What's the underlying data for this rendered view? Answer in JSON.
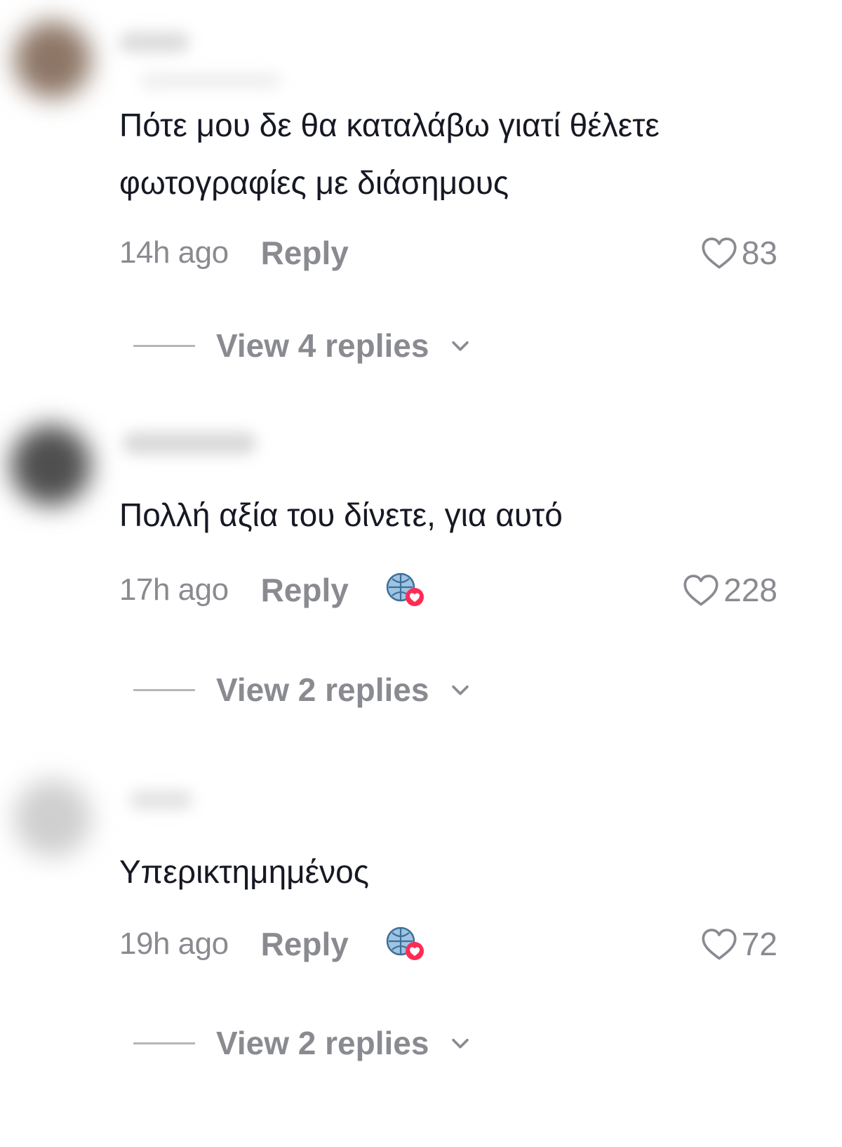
{
  "comments": [
    {
      "text": "Πότε μου δε θα καταλάβω γιατί θέλετε φωτογραφίες με διάσημους",
      "time": "14h ago",
      "reply_label": "Reply",
      "likes": "83",
      "view_replies": "View 4 replies",
      "creator_liked": false
    },
    {
      "text": "Πολλή αξία του δίνετε, για αυτό",
      "time": "17h ago",
      "reply_label": "Reply",
      "likes": "228",
      "view_replies": "View 2 replies",
      "creator_liked": true
    },
    {
      "text": "Υπερικτημημένος",
      "time": "19h ago",
      "reply_label": "Reply",
      "likes": "72",
      "view_replies": "View 2 replies",
      "creator_liked": true
    }
  ],
  "icons": {
    "like": "heart-outline-icon",
    "expand": "chevron-down-icon",
    "creator_liked": "creator-liked-badge-icon"
  },
  "colors": {
    "text_primary": "#161823",
    "text_secondary": "#8a8b91",
    "heart_badge": "#fe2c55"
  }
}
